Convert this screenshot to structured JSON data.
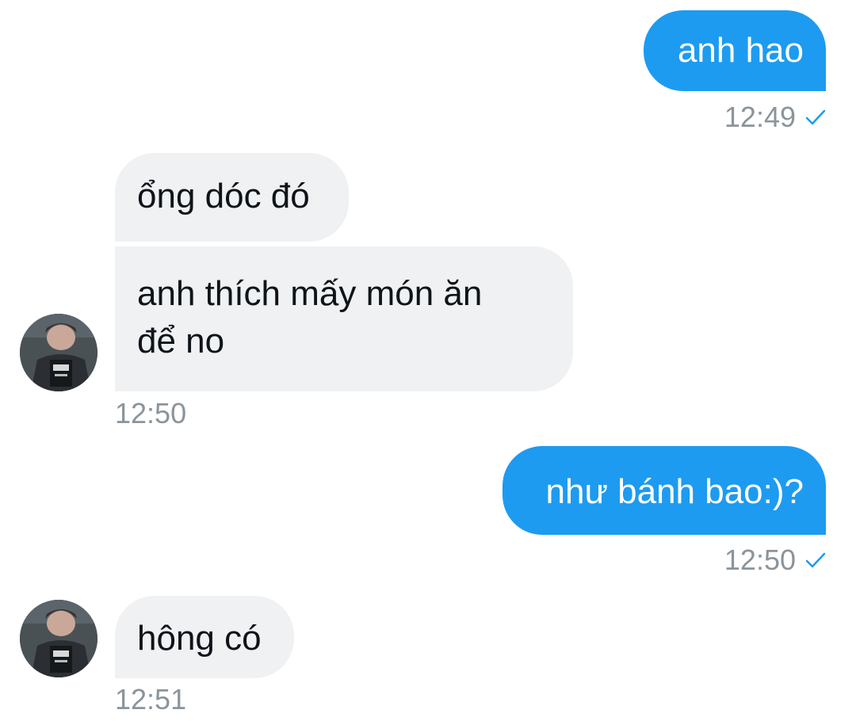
{
  "conversation": {
    "accent_color": "#1d9bf0",
    "received_bubble_color": "#eff1f3",
    "messages": [
      {
        "direction": "sent",
        "text": "anh hao",
        "time": "12:49",
        "status_icon": "check-icon"
      },
      {
        "direction": "received",
        "text": "ổng dóc đó"
      },
      {
        "direction": "received",
        "line1": "anh thích mấy món ăn",
        "line2": "để no",
        "time": "12:50",
        "avatar_icon": "avatar-image"
      },
      {
        "direction": "sent",
        "text": "như bánh bao:)?",
        "time": "12:50",
        "status_icon": "check-icon"
      },
      {
        "direction": "received",
        "text": "hông có",
        "time": "12:51",
        "avatar_icon": "avatar-image"
      }
    ]
  }
}
